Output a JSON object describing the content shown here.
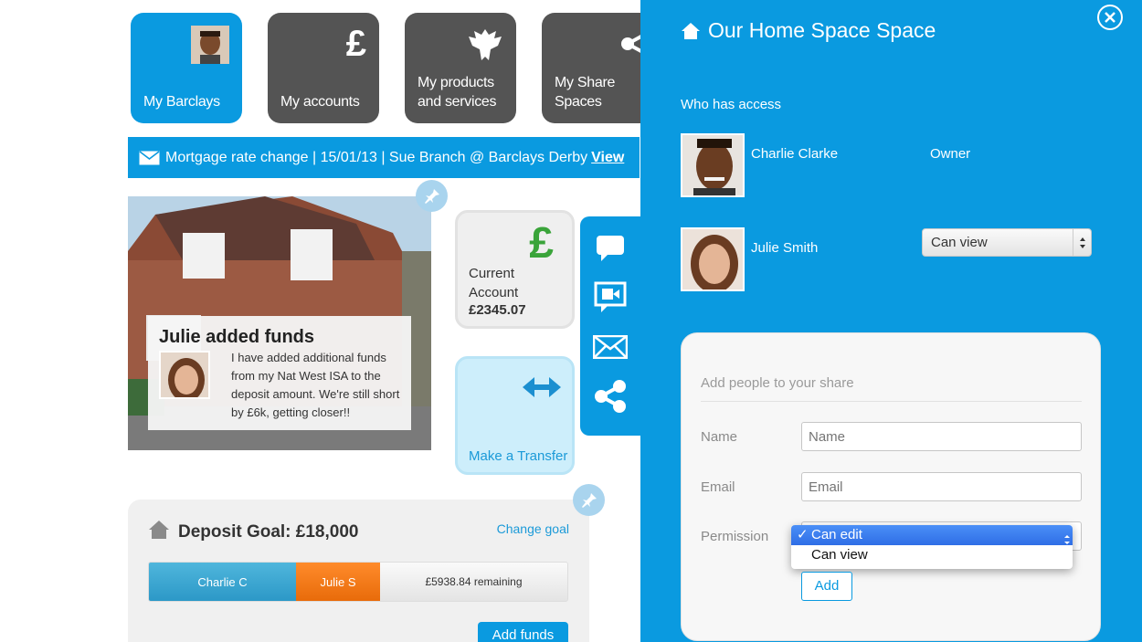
{
  "tiles": [
    {
      "label": "My Barclays",
      "icon": "user-photo"
    },
    {
      "label": "My accounts",
      "icon": "pound-icon"
    },
    {
      "label_line1": "My products",
      "label_line2": "and services",
      "icon": "eagle-icon"
    },
    {
      "label_line1": "My Share",
      "label_line2": "Spaces",
      "icon": "share-icon"
    }
  ],
  "message_bar": {
    "text": "Mortgage rate change | 15/01/13 | Sue Branch @ Barclays Derby",
    "link": "View"
  },
  "note": {
    "title": "Julie added funds",
    "text": "I have added additional funds from my Nat West ISA to the deposit amount. We're still short by £6k, getting closer!!"
  },
  "current_account": {
    "symbol": "£",
    "label_line1": "Current",
    "label_line2": "Account",
    "amount": "£2345.07"
  },
  "transfer": {
    "label": "Make a Transfer"
  },
  "goal": {
    "title": "Deposit Goal: £18,000",
    "change_link": "Change goal",
    "segments": [
      {
        "label": "Charlie C",
        "color": "#2c98c7"
      },
      {
        "label": "Julie S",
        "color": "#e86b0a"
      }
    ],
    "remaining": "£5938.84 remaining",
    "add_funds": "Add funds"
  },
  "panel": {
    "title": "Our Home Space Space",
    "who_has_access": "Who has access",
    "people": [
      {
        "name": "Charlie Clarke",
        "role": "Owner"
      },
      {
        "name": "Julie Smith",
        "permission": "Can view"
      }
    ],
    "form": {
      "heading": "Add people to your share",
      "name_label": "Name",
      "name_placeholder": "Name",
      "email_label": "Email",
      "email_placeholder": "Email",
      "permission_label": "Permission",
      "options": [
        "Can edit",
        "Can view"
      ],
      "selected_mark": "✓",
      "add_label": "Add"
    }
  },
  "colors": {
    "brand_blue": "#0a9ae0",
    "dark_tile": "#545454",
    "green": "#3aa43a",
    "orange": "#e86b0a"
  }
}
